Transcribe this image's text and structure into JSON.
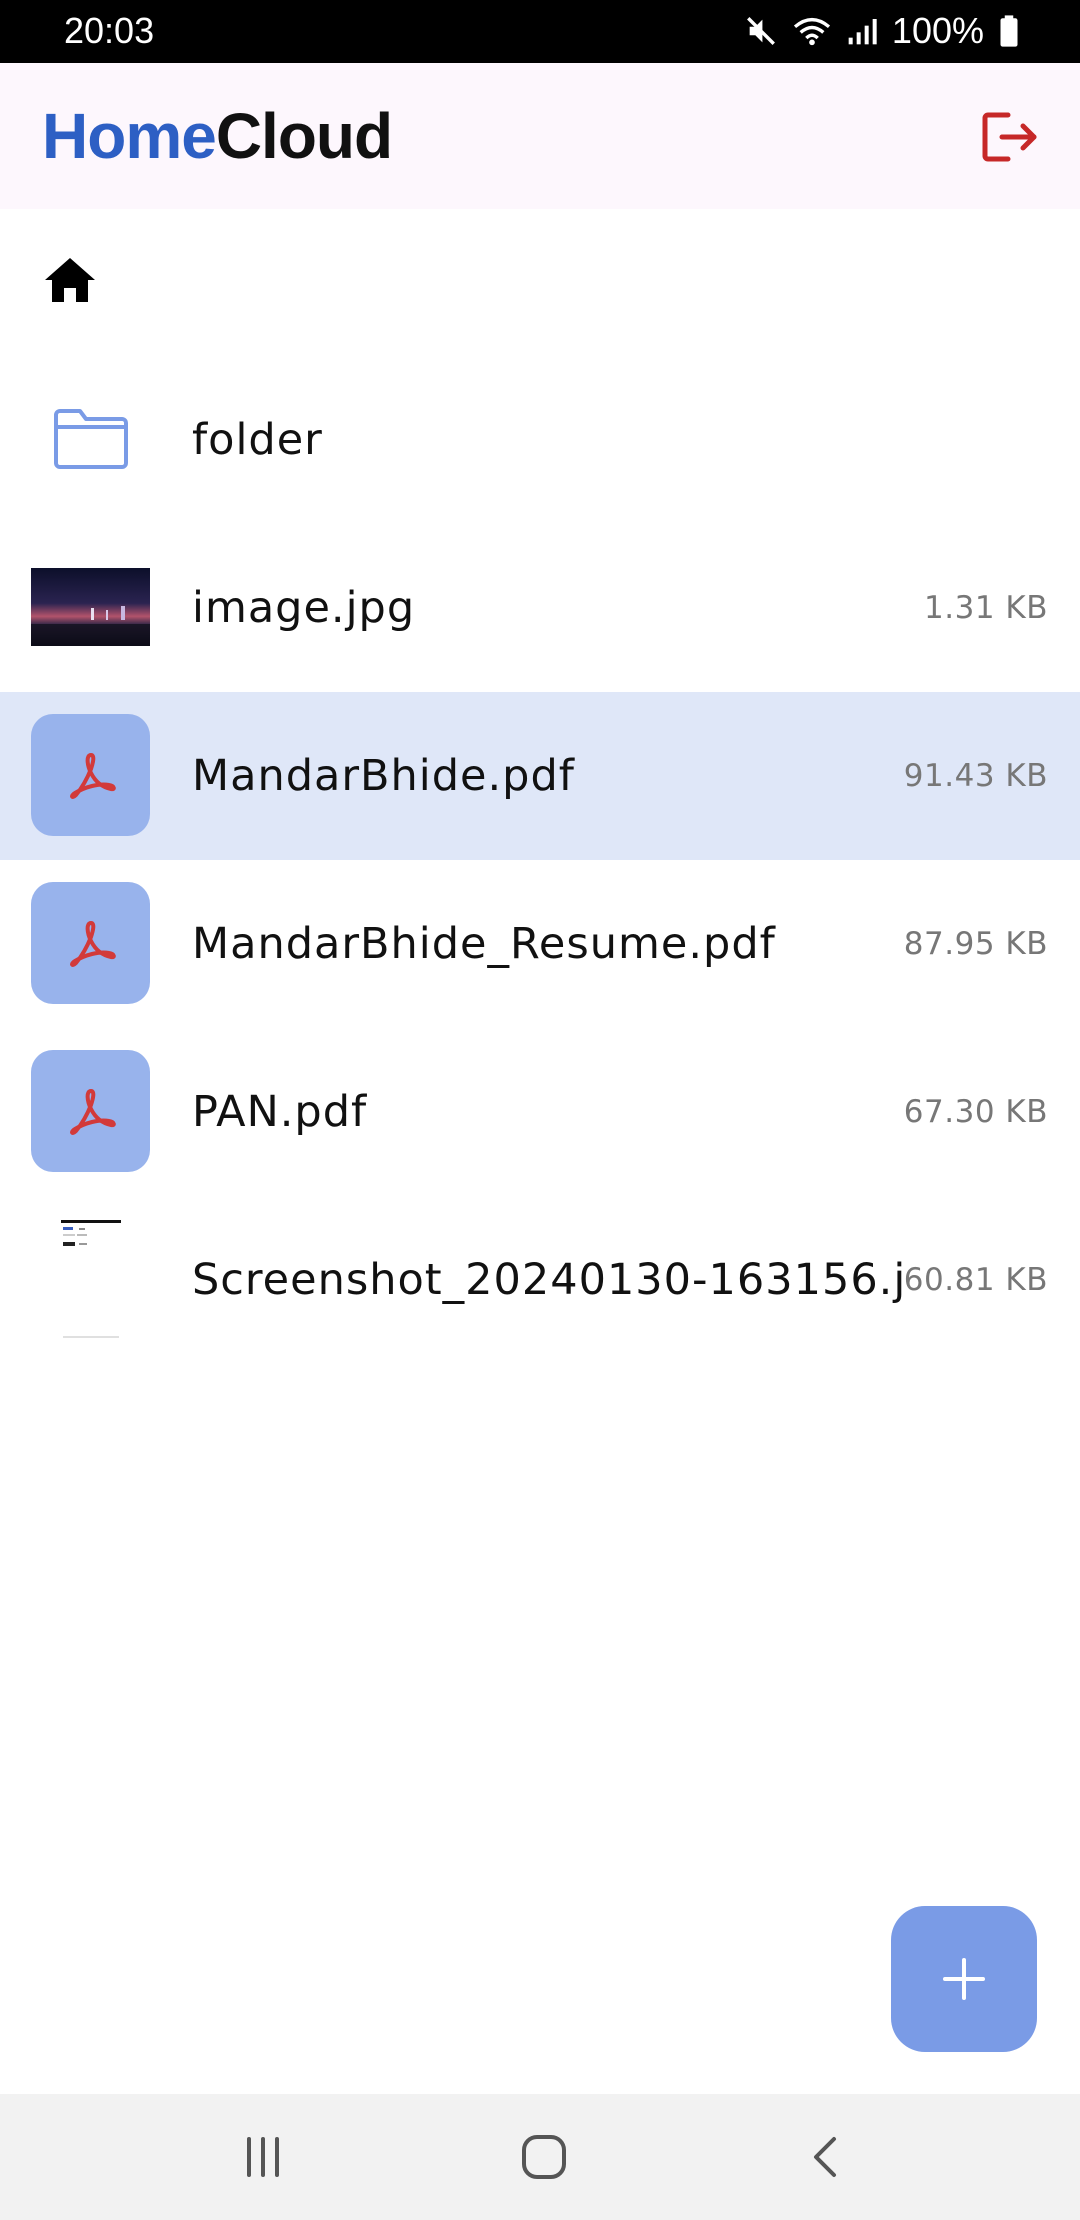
{
  "status_bar": {
    "time": "20:03",
    "battery": "100%",
    "icons": [
      "mute-icon",
      "wifi-icon",
      "signal-icon",
      "battery-icon"
    ]
  },
  "app_bar": {
    "title_part1": "Home",
    "title_part2": "Cloud",
    "logout_icon": "logout-icon"
  },
  "breadcrumb": {
    "icon": "home-icon"
  },
  "files": [
    {
      "name": "folder",
      "size": "",
      "type": "folder"
    },
    {
      "name": "image.jpg",
      "size": "1.31 KB",
      "type": "image"
    },
    {
      "name": "MandarBhide.pdf",
      "size": "91.43 KB",
      "type": "pdf",
      "selected": true
    },
    {
      "name": "MandarBhide_Resume.pdf",
      "size": "87.95 KB",
      "type": "pdf"
    },
    {
      "name": "PAN.pdf",
      "size": "67.30 KB",
      "type": "pdf"
    },
    {
      "name": "Screenshot_20240130-163156.j",
      "size": "60.81 KB",
      "type": "screenshot"
    }
  ],
  "fab": {
    "icon": "plus-icon"
  },
  "nav_bar": {
    "icons": [
      "recents-icon",
      "home-nav-icon",
      "back-icon"
    ]
  },
  "colors": {
    "brand_blue": "#2d5fc4",
    "selected_row": "#dfe7f8",
    "pdf_tile": "#98b3ec",
    "fab": "#7a9be6",
    "logout": "#c62828"
  }
}
